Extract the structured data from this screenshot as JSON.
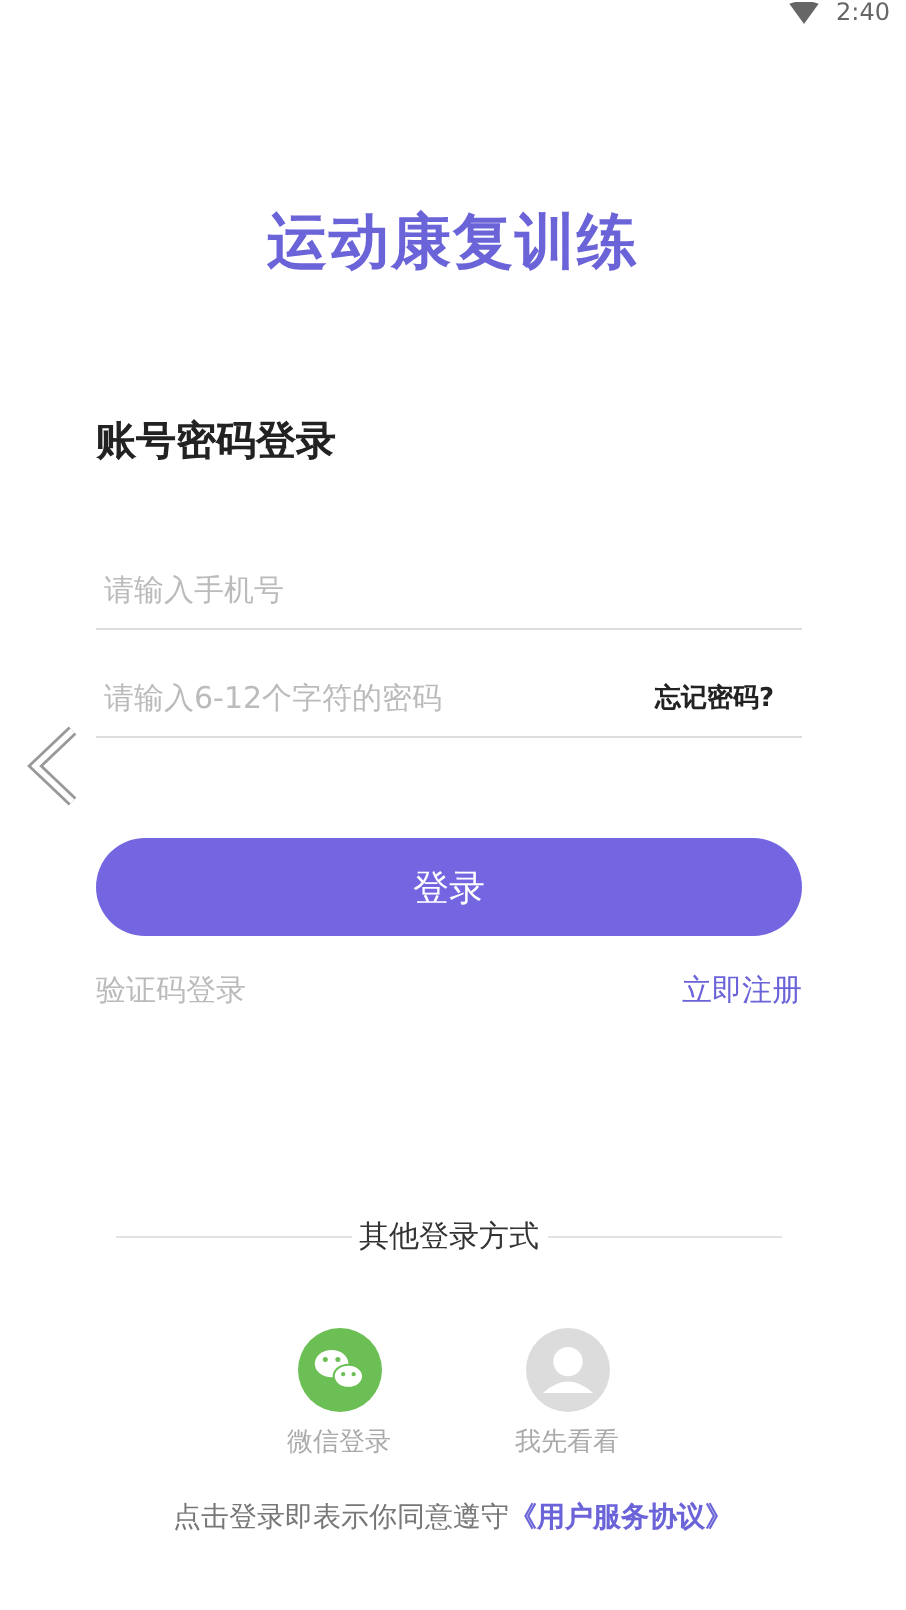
{
  "status_bar": {
    "time": "2:40"
  },
  "app_title": "运动康复训练",
  "form_title": "账号密码登录",
  "phone_field": {
    "placeholder": "请输入手机号"
  },
  "password_field": {
    "placeholder": "请输入6-12个字符的密码"
  },
  "forgot_link": "忘记密码?",
  "login_button": "登录",
  "sms_login_link": "验证码登录",
  "register_link": "立即注册",
  "other_methods_title": "其他登录方式",
  "other_methods": [
    {
      "kind": "wechat",
      "label": "微信登录"
    },
    {
      "kind": "guest",
      "label": "我先看看"
    }
  ],
  "agreement": {
    "text": "点击登录即表示你同意遵守",
    "link": "《用户服务协议》"
  }
}
